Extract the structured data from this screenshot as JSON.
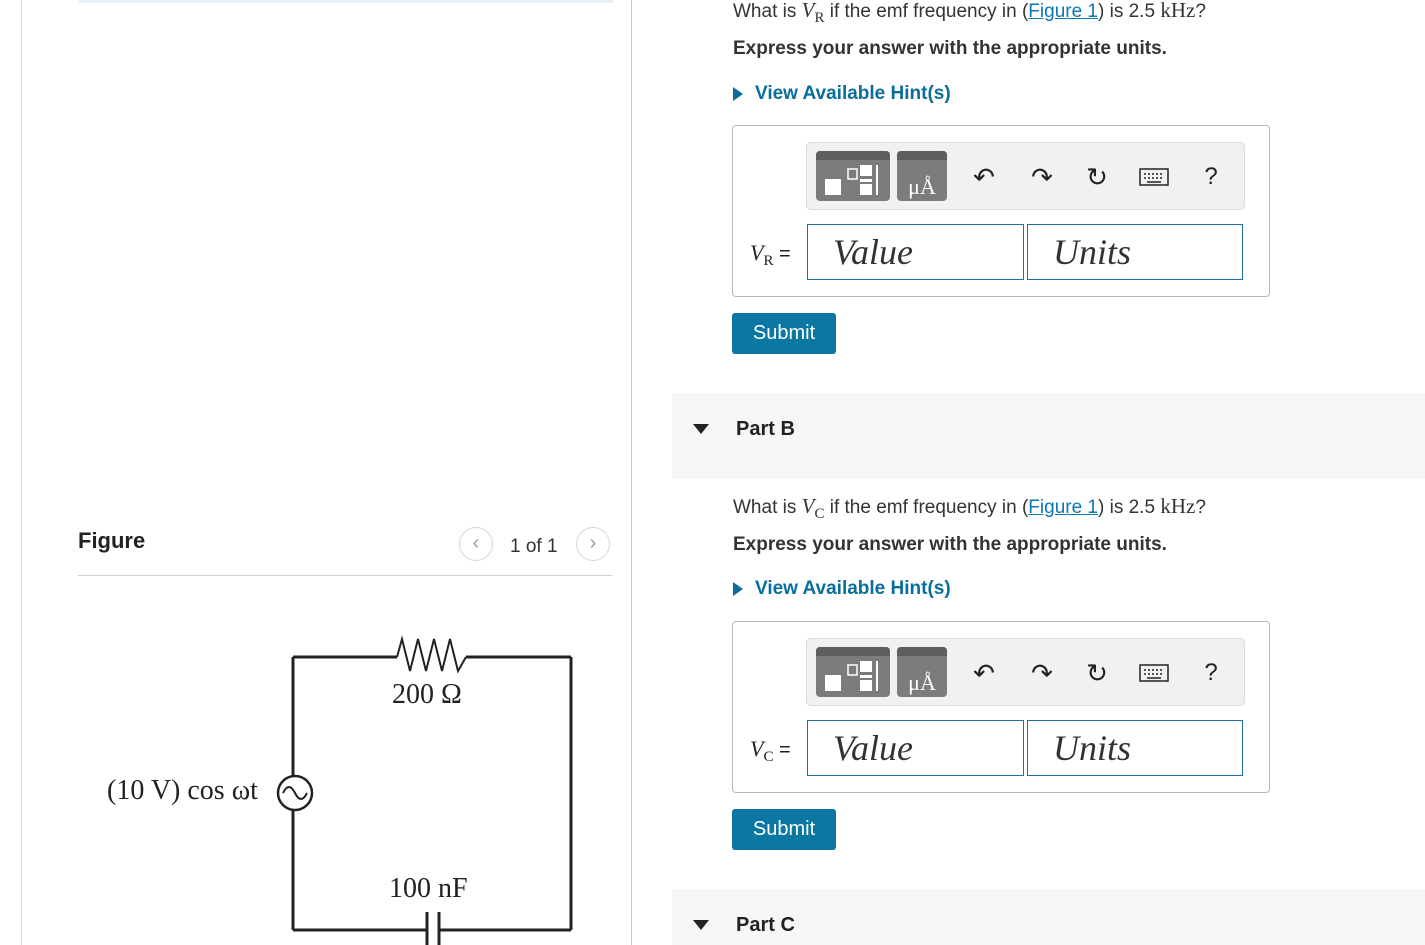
{
  "figure": {
    "title": "Figure",
    "counter": "1 of 1",
    "prev_icon": "chevron-left-icon",
    "next_icon": "chevron-right-icon",
    "circuit": {
      "resistor_label": "200 Ω",
      "source_label": "(10 V) cos ωt",
      "capacitor_label": "100 nF"
    }
  },
  "partA": {
    "question_prefix": "What is ",
    "var": "V",
    "var_sub": "R",
    "question_mid": " if the emf frequency in (",
    "figure_link": "Figure 1",
    "question_mid2": ") is ",
    "freq_value": "2.5 ",
    "freq_unit": "kHz",
    "question_end": "?",
    "instruction": "Express your answer with the appropriate units.",
    "hint_label": "View Available Hint(s)",
    "input_var": "V",
    "input_var_sub": "R",
    "equals": " =",
    "value_placeholder": "Value",
    "units_placeholder": "Units",
    "submit_label": "Submit"
  },
  "partB": {
    "title": "Part B",
    "question_prefix": "What is ",
    "var": "V",
    "var_sub": "C",
    "question_mid": " if the emf frequency in (",
    "figure_link": "Figure 1",
    "question_mid2": ") is ",
    "freq_value": "2.5 ",
    "freq_unit": "kHz",
    "question_end": "?",
    "instruction": "Express your answer with the appropriate units.",
    "hint_label": "View Available Hint(s)",
    "input_var": "V",
    "input_var_sub": "C",
    "equals": " =",
    "value_placeholder": "Value",
    "units_placeholder": "Units",
    "submit_label": "Submit"
  },
  "partC": {
    "title": "Part C"
  },
  "toolbar": {
    "units_symbol": "μÅ",
    "help": "?",
    "icons": [
      "templates-icon",
      "units-icon",
      "undo-icon",
      "redo-icon",
      "reset-icon",
      "keyboard-icon",
      "help-icon"
    ]
  },
  "colors": {
    "accent": "#0b77a3",
    "link": "#0a77b6",
    "input_border": "#1c6fa7"
  }
}
